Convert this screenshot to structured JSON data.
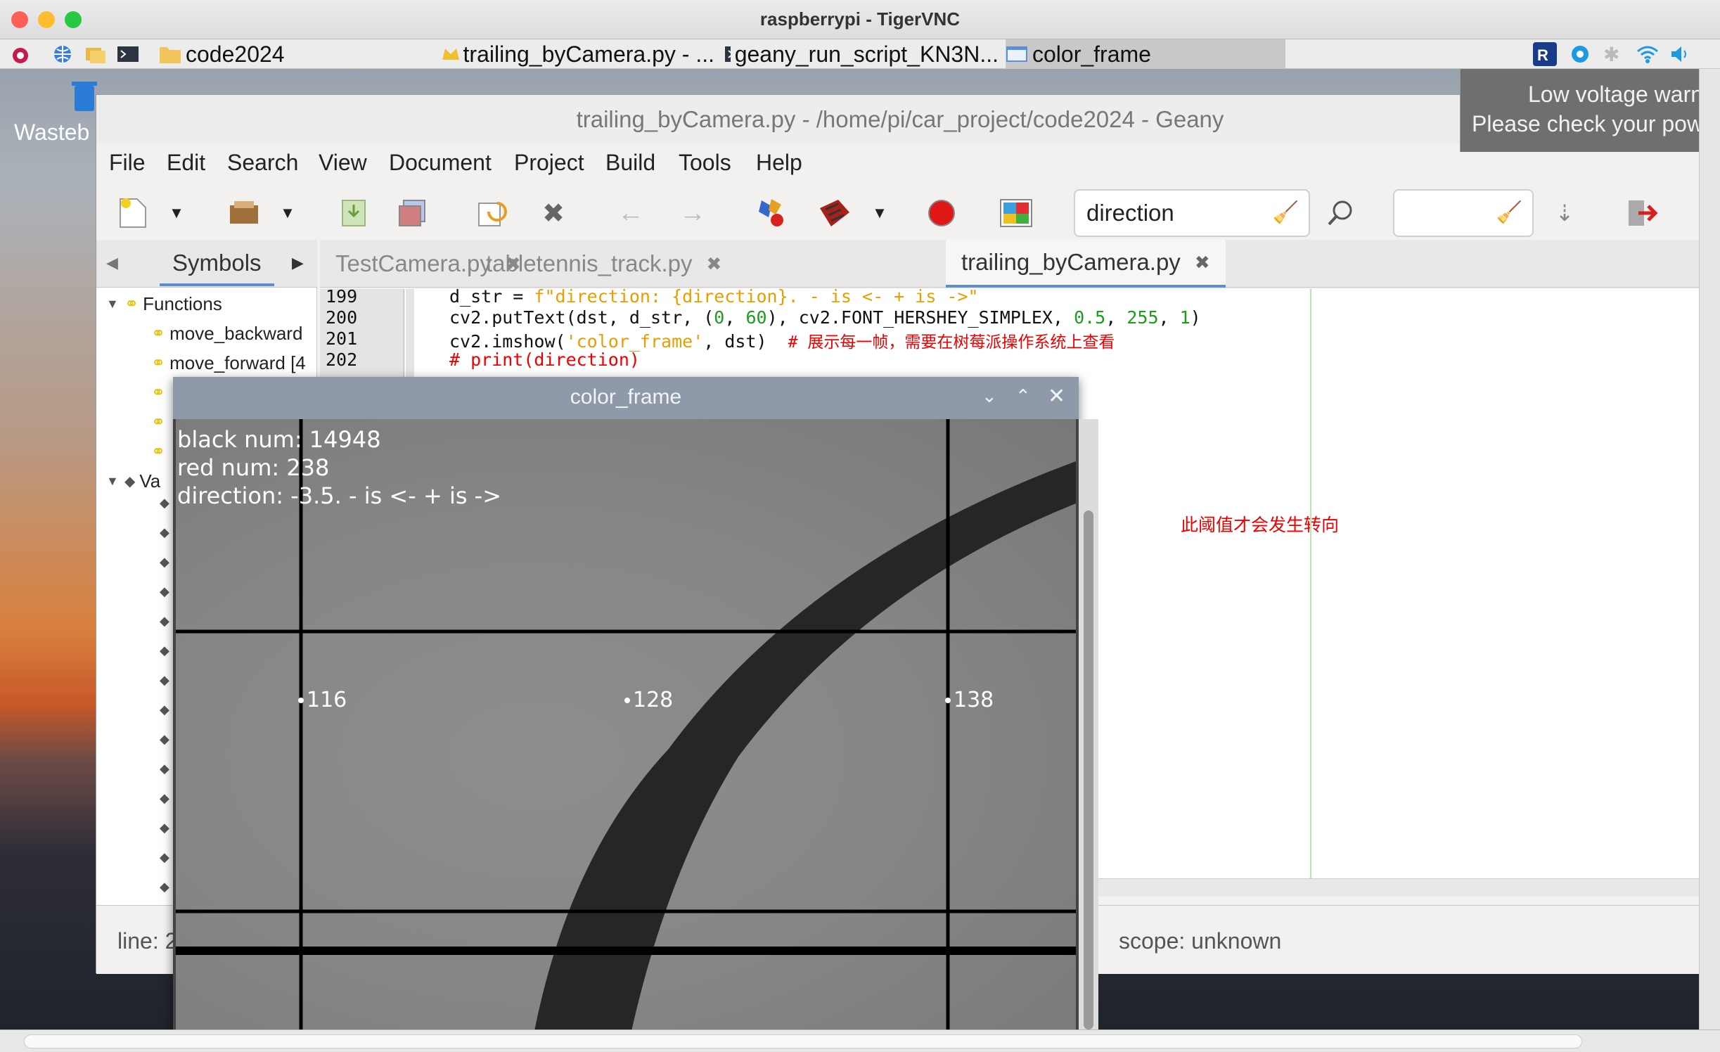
{
  "mac": {
    "title": "raspberrypi - TigerVNC"
  },
  "taskbar": {
    "items": [
      {
        "label": "code2024"
      },
      {
        "label": "trailing_byCamera.py - ..."
      },
      {
        "label": "geany_run_script_KN3N..."
      },
      {
        "label": "color_frame"
      }
    ]
  },
  "desktop": {
    "wastebasket_label": "Wasteb"
  },
  "notification": {
    "line1": "Low voltage warn",
    "line2": "Please check your pow"
  },
  "geany": {
    "title": "trailing_byCamera.py - /home/pi/car_project/code2024 - Geany",
    "menu": [
      "File",
      "Edit",
      "Search",
      "View",
      "Document",
      "Project",
      "Build",
      "Tools",
      "Help"
    ],
    "search_value": "direction",
    "goto_value": "",
    "sidebar": {
      "tab_label": "Symbols",
      "functions_label": "Functions",
      "func_items": [
        "move_backward",
        "move_forward [4"
      ],
      "variables_label": "Va"
    },
    "tabs": [
      "TestCamera.py",
      "tabletennis_track.py",
      "trailing_byCamera.py"
    ],
    "code": {
      "lines": [
        "199",
        "200",
        "201",
        "202"
      ],
      "l199_a": "d_str = ",
      "l199_b": "f\"direction: {direction}. - is <- + is ->\"",
      "l200_a": "cv2.putText(dst, d_str, (",
      "l200_n1": "0",
      "l200_b": ", ",
      "l200_n2": "60",
      "l200_c": "), cv2.FONT_HERSHEY_SIMPLEX, ",
      "l200_n3": "0.5",
      "l200_d": ", ",
      "l200_n4": "255",
      "l200_e": ", ",
      "l200_n5": "1",
      "l200_f": ")",
      "l201_a": "cv2.imshow(",
      "l201_b": "'color_frame'",
      "l201_c": ", dst)  ",
      "l201_d": "# 展示每一帧，需要在树莓派操作系统上查看",
      "l202": "# print(direction)",
      "hidden_comment": "此阈值才会发生转向"
    },
    "status": {
      "line": "line: 2",
      "scope": "scope: unknown"
    }
  },
  "color_frame": {
    "title": "color_frame",
    "text_black": "black num: 14948",
    "text_red": "red num: 238",
    "text_direction": "direction: -3.5. - is <- + is ->",
    "labels": [
      "116",
      "128",
      "138"
    ]
  }
}
